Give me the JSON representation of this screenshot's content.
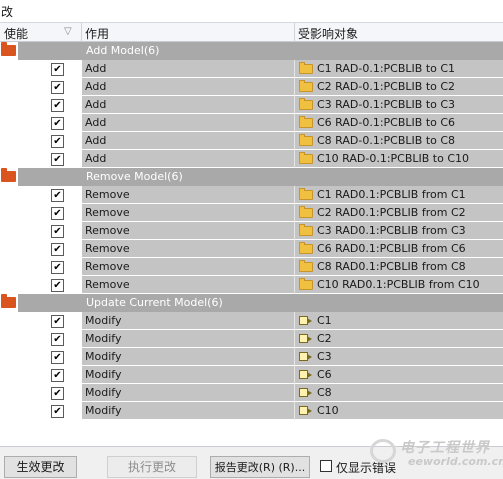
{
  "window": {
    "title": "改"
  },
  "columns": {
    "enable": "使能",
    "action": "作用",
    "affected": "受影响对象"
  },
  "groups": [
    {
      "label": "Add Model(6)",
      "rows": [
        {
          "checked": true,
          "action": "Add",
          "target": "C1 RAD-0.1:PCBLIB to C1",
          "icon": "folder-icon"
        },
        {
          "checked": true,
          "action": "Add",
          "target": "C2 RAD-0.1:PCBLIB to C2",
          "icon": "folder-icon"
        },
        {
          "checked": true,
          "action": "Add",
          "target": "C3 RAD-0.1:PCBLIB to C3",
          "icon": "folder-icon"
        },
        {
          "checked": true,
          "action": "Add",
          "target": "C6 RAD-0.1:PCBLIB to C6",
          "icon": "folder-icon"
        },
        {
          "checked": true,
          "action": "Add",
          "target": "C8 RAD-0.1:PCBLIB to C8",
          "icon": "folder-icon"
        },
        {
          "checked": true,
          "action": "Add",
          "target": "C10 RAD-0.1:PCBLIB to C10",
          "icon": "folder-icon"
        }
      ]
    },
    {
      "label": "Remove Model(6)",
      "rows": [
        {
          "checked": true,
          "action": "Remove",
          "target": "C1 RAD0.1:PCBLIB from C1",
          "icon": "folder-icon"
        },
        {
          "checked": true,
          "action": "Remove",
          "target": "C2 RAD0.1:PCBLIB from C2",
          "icon": "folder-icon"
        },
        {
          "checked": true,
          "action": "Remove",
          "target": "C3 RAD0.1:PCBLIB from C3",
          "icon": "folder-icon"
        },
        {
          "checked": true,
          "action": "Remove",
          "target": "C6 RAD0.1:PCBLIB from C6",
          "icon": "folder-icon"
        },
        {
          "checked": true,
          "action": "Remove",
          "target": "C8 RAD0.1:PCBLIB from C8",
          "icon": "folder-icon"
        },
        {
          "checked": true,
          "action": "Remove",
          "target": "C10 RAD0.1:PCBLIB from C10",
          "icon": "folder-icon"
        }
      ]
    },
    {
      "label": "Update Current Model(6)",
      "rows": [
        {
          "checked": true,
          "action": "Modify",
          "target": "C1",
          "icon": "component-icon"
        },
        {
          "checked": true,
          "action": "Modify",
          "target": "C2",
          "icon": "component-icon"
        },
        {
          "checked": true,
          "action": "Modify",
          "target": "C3",
          "icon": "component-icon"
        },
        {
          "checked": true,
          "action": "Modify",
          "target": "C6",
          "icon": "component-icon"
        },
        {
          "checked": true,
          "action": "Modify",
          "target": "C8",
          "icon": "component-icon"
        },
        {
          "checked": true,
          "action": "Modify",
          "target": "C10",
          "icon": "component-icon"
        }
      ]
    }
  ],
  "buttons": {
    "validate": "生效更改",
    "execute": "执行更改",
    "report": "报告更改(R) (R)...",
    "only_errors": "仅显示错误"
  },
  "watermark": {
    "line1": "电子工程世界",
    "line2": "eeworld.com.cn"
  },
  "colors": {
    "group_band": "#a9a9a9",
    "row_bg": "#c4c4c4",
    "folder_red": "#d9541e",
    "folder_yellow": "#f0c040"
  }
}
